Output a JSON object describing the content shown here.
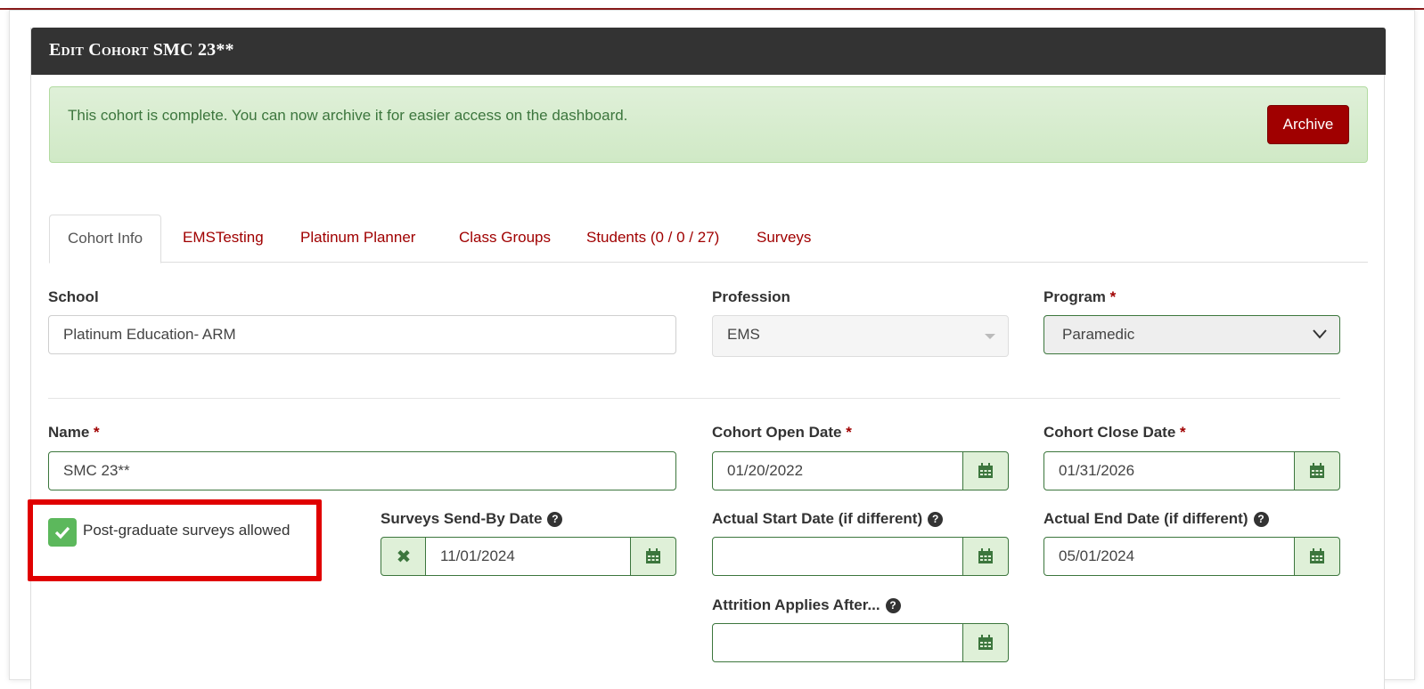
{
  "header": {
    "title": "Edit Cohort SMC 23**"
  },
  "alert": {
    "message": "This cohort is complete. You can now archive it for easier access on the dashboard.",
    "archive_label": "Archive"
  },
  "tabs": [
    {
      "label": "Cohort Info",
      "active": true
    },
    {
      "label": "EMSTesting"
    },
    {
      "label": "Platinum Planner"
    },
    {
      "label": "Class Groups"
    },
    {
      "label": "Students (0 / 0 / 27)"
    },
    {
      "label": "Surveys"
    }
  ],
  "form": {
    "school": {
      "label": "School",
      "value": "Platinum Education- ARM"
    },
    "profession": {
      "label": "Profession",
      "value": "EMS"
    },
    "program": {
      "label": "Program",
      "required": "*",
      "value": "Paramedic"
    },
    "name": {
      "label": "Name",
      "required": "*",
      "value": "SMC 23**"
    },
    "open_date": {
      "label": "Cohort Open Date",
      "required": "*",
      "value": "01/20/2022"
    },
    "close_date": {
      "label": "Cohort Close Date",
      "required": "*",
      "value": "01/31/2026"
    },
    "surveys_allowed": {
      "label": "Post-graduate surveys allowed",
      "checked": true
    },
    "send_by": {
      "label": "Surveys Send-By Date",
      "value": "11/01/2024"
    },
    "actual_start": {
      "label": "Actual Start Date (if different)",
      "value": ""
    },
    "actual_end": {
      "label": "Actual End Date (if different)",
      "value": "05/01/2024"
    },
    "attrition": {
      "label": "Attrition Applies After...",
      "value": ""
    }
  },
  "icons": {
    "help": "?",
    "clear": "✖"
  },
  "colors": {
    "accent": "#a00000",
    "success_bg": "#dff0d8",
    "success_text": "#3c763d",
    "header_bg": "#333333",
    "highlight": "#e00000"
  }
}
